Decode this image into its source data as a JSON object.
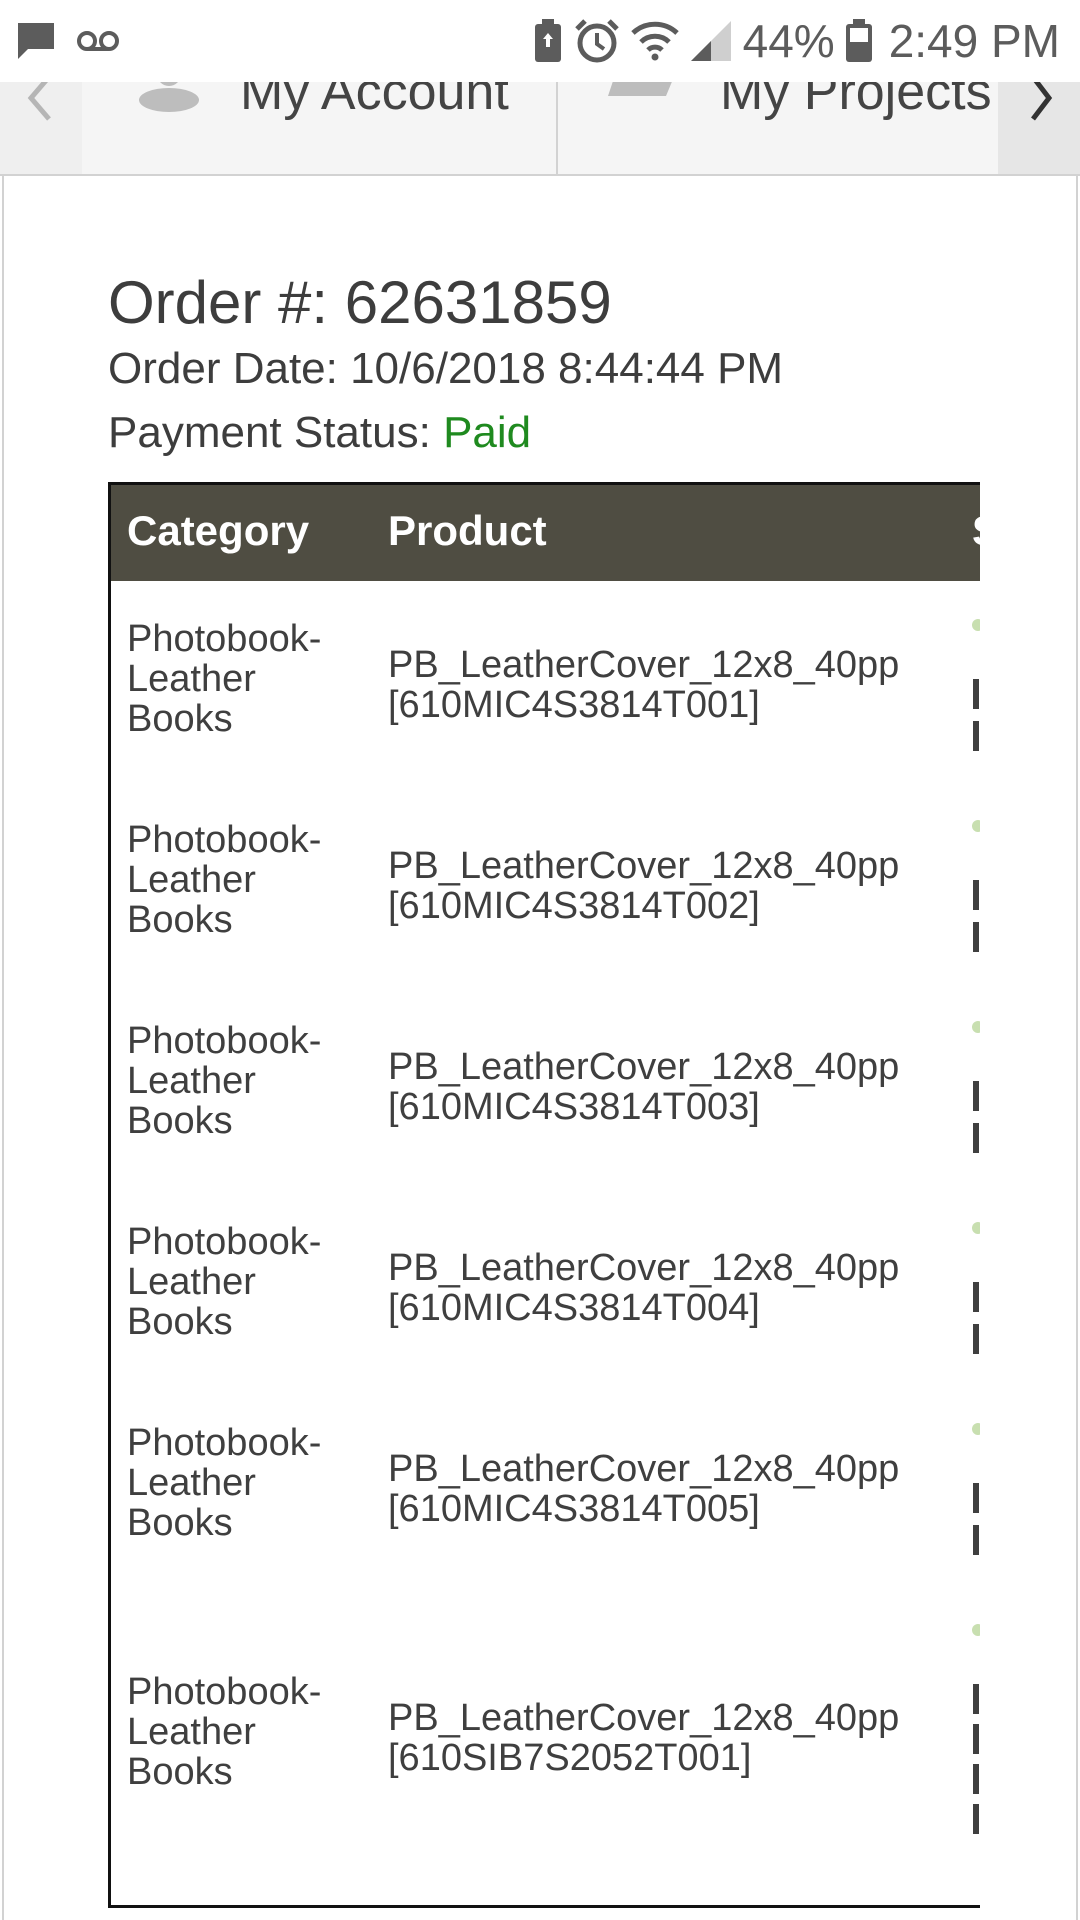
{
  "status_bar": {
    "battery_percent": "44%",
    "time": "2:49 PM",
    "icons": [
      "message-icon",
      "voicemail-icon",
      "battery-saver-icon",
      "alarm-icon",
      "wifi-icon",
      "signal-icon",
      "battery-icon"
    ]
  },
  "nav": {
    "tabs": [
      {
        "label": "My Account",
        "icon": "account-icon"
      },
      {
        "label": "My Projects",
        "icon": "folder-icon"
      }
    ]
  },
  "order": {
    "title": "Order #: 62631859",
    "date": "Order Date: 10/6/2018 8:44:44 PM",
    "payment_label": "Payment Status: ",
    "payment_value": "Paid",
    "payment_color": "#1f8a1f"
  },
  "table": {
    "header_bg": "#4f4d42",
    "columns": [
      "Category",
      "Product",
      "S"
    ],
    "rows": [
      {
        "category": "Photobook-Leather Books",
        "product": "PB_LeatherCover_12x8_40pp [610MIC4S3814T001]"
      },
      {
        "category": "Photobook-Leather Books",
        "product": "PB_LeatherCover_12x8_40pp [610MIC4S3814T002]"
      },
      {
        "category": "Photobook-Leather Books",
        "product": "PB_LeatherCover_12x8_40pp [610MIC4S3814T003]"
      },
      {
        "category": "Photobook-Leather Books",
        "product": "PB_LeatherCover_12x8_40pp [610MIC4S3814T004]"
      },
      {
        "category": "Photobook-Leather Books",
        "product": "PB_LeatherCover_12x8_40pp [610MIC4S3814T005]"
      },
      {
        "category": "Photobook-Leather Books",
        "product": "PB_LeatherCover_12x8_40pp [610SIB7S2052T001]"
      }
    ]
  }
}
